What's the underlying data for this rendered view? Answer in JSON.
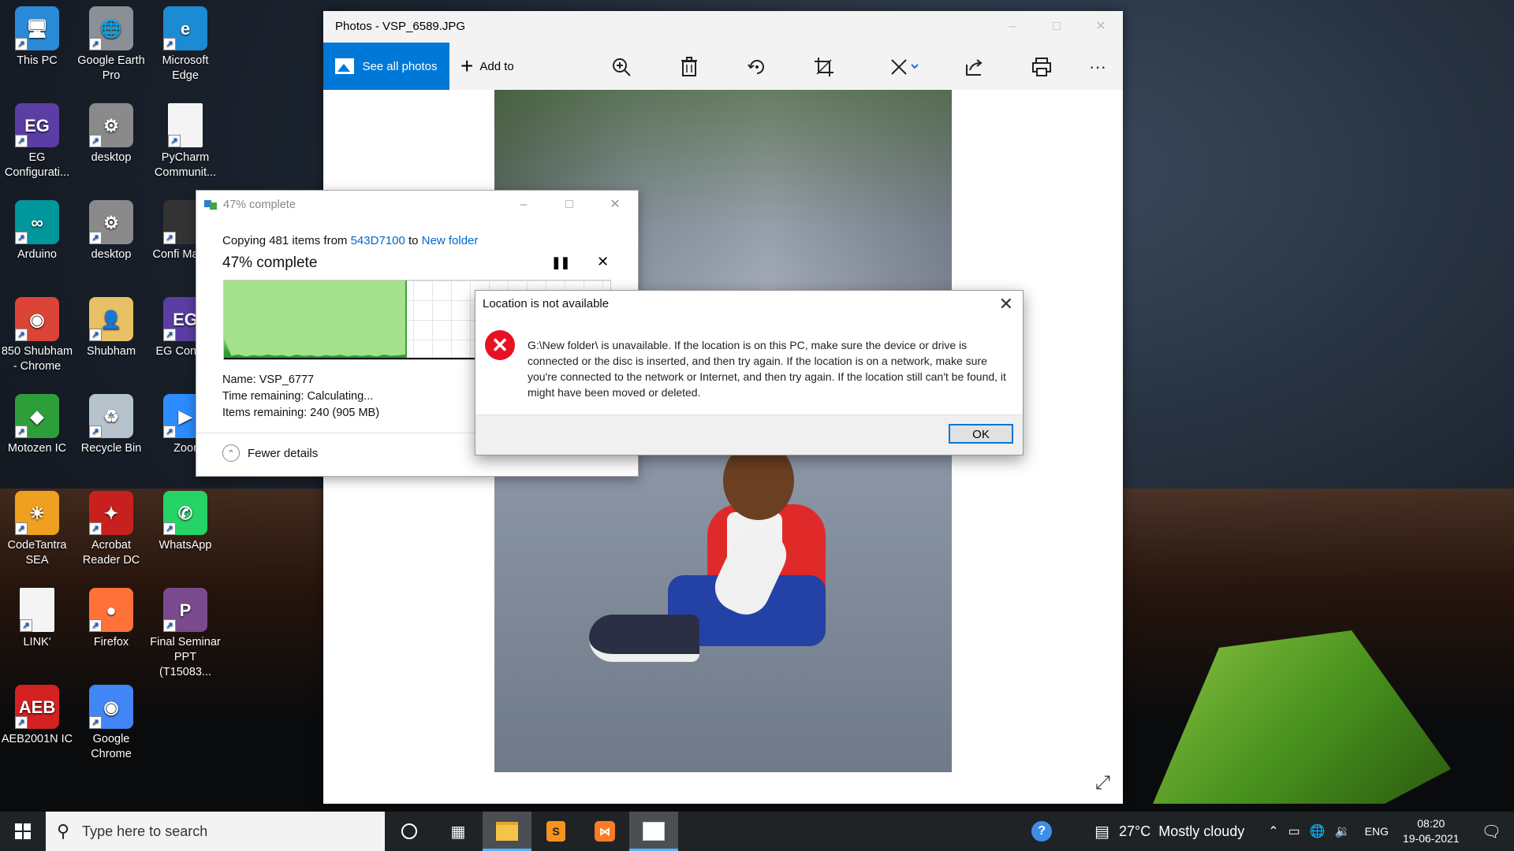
{
  "desktop": {
    "icons": [
      {
        "label": "This PC",
        "icon": "this-pc-icon",
        "color": "#2a8ad8"
      },
      {
        "label": "Google Earth Pro",
        "icon": "google-earth-icon",
        "color": "#8b8f96"
      },
      {
        "label": "Microsoft Edge",
        "icon": "edge-icon",
        "color": "#1d8bd3"
      },
      {
        "label": "EG Configurati...",
        "icon": "eg-config-icon",
        "color": "#5b3ea3"
      },
      {
        "label": "desktop",
        "icon": "settings-file-icon",
        "color": "#8a8a8a"
      },
      {
        "label": "PyCharm Communit...",
        "icon": "blank-file-icon",
        "color": "#f4f4f4"
      },
      {
        "label": "Arduino",
        "icon": "arduino-icon",
        "color": "#00979c"
      },
      {
        "label": "desktop",
        "icon": "settings-file-icon",
        "color": "#8a8a8a"
      },
      {
        "label": "Confi Mantra",
        "icon": "config-mantra-icon",
        "color": "#333333"
      },
      {
        "label": "850 Shubham - Chrome",
        "icon": "chrome-profile-icon",
        "color": "#db4437"
      },
      {
        "label": "Shubham",
        "icon": "user-folder-icon",
        "color": "#e8c065"
      },
      {
        "label": "EG Configu",
        "icon": "eg-config-icon",
        "color": "#5b3ea3"
      },
      {
        "label": "Motozen IC",
        "icon": "motozen-icon",
        "color": "#2e9e3a"
      },
      {
        "label": "Recycle Bin",
        "icon": "recycle-bin-icon",
        "color": "#b7c3cc"
      },
      {
        "label": "Zoor",
        "icon": "zoom-icon",
        "color": "#2d8cff"
      },
      {
        "label": "CodeTantra SEA",
        "icon": "codetantra-icon",
        "color": "#f0a020"
      },
      {
        "label": "Acrobat Reader DC",
        "icon": "acrobat-icon",
        "color": "#c7201f"
      },
      {
        "label": "WhatsApp",
        "icon": "whatsapp-icon",
        "color": "#25d366"
      },
      {
        "label": "LINK'",
        "icon": "blank-file-icon",
        "color": "#f4f4f4"
      },
      {
        "label": "Firefox",
        "icon": "firefox-icon",
        "color": "#ff7139"
      },
      {
        "label": "Final Seminar PPT (T15083...",
        "icon": "ppt-thumbnail-icon",
        "color": "#7a4a8c"
      },
      {
        "label": "AEB2001N IC",
        "icon": "aeb-icon",
        "color": "#d32020"
      },
      {
        "label": "Google Chrome",
        "icon": "chrome-icon",
        "color": "#4285f4"
      }
    ]
  },
  "photos": {
    "title": "Photos - VSP_6589.JPG",
    "see_all": "See all photos",
    "add_to": "Add to",
    "tools": [
      "zoom-in-icon",
      "delete-icon",
      "rotate-icon",
      "crop-icon",
      "edit-icon",
      "share-icon",
      "print-icon",
      "more-icon"
    ],
    "accent": "#0078d7"
  },
  "copy_dialog": {
    "title": "47% complete",
    "copy_prefix": "Copying 481 items from",
    "source": "543D7100",
    "to": "to",
    "destination": "New folder",
    "progress_text": "47% complete",
    "progress_fraction": 0.47,
    "name": "Name: VSP_6777",
    "time_remaining": "Time remaining: Calculating...",
    "items_remaining": "Items remaining: 240 (905 MB)",
    "fewer_details": "Fewer details"
  },
  "error_dialog": {
    "title": "Location is not available",
    "message": "G:\\New folder\\ is unavailable. If the location is on this PC, make sure the device or drive is connected or the disc is inserted, and then try again. If the location is on a network, make sure you're connected to the network or Internet, and then try again. If the location still can't be found, it might have been moved or deleted.",
    "ok": "OK"
  },
  "taskbar": {
    "search_placeholder": "Type here to search",
    "weather": "27°C  Mostly cloudy",
    "language": "ENG",
    "time": "08:20",
    "date": "19-06-2021"
  }
}
